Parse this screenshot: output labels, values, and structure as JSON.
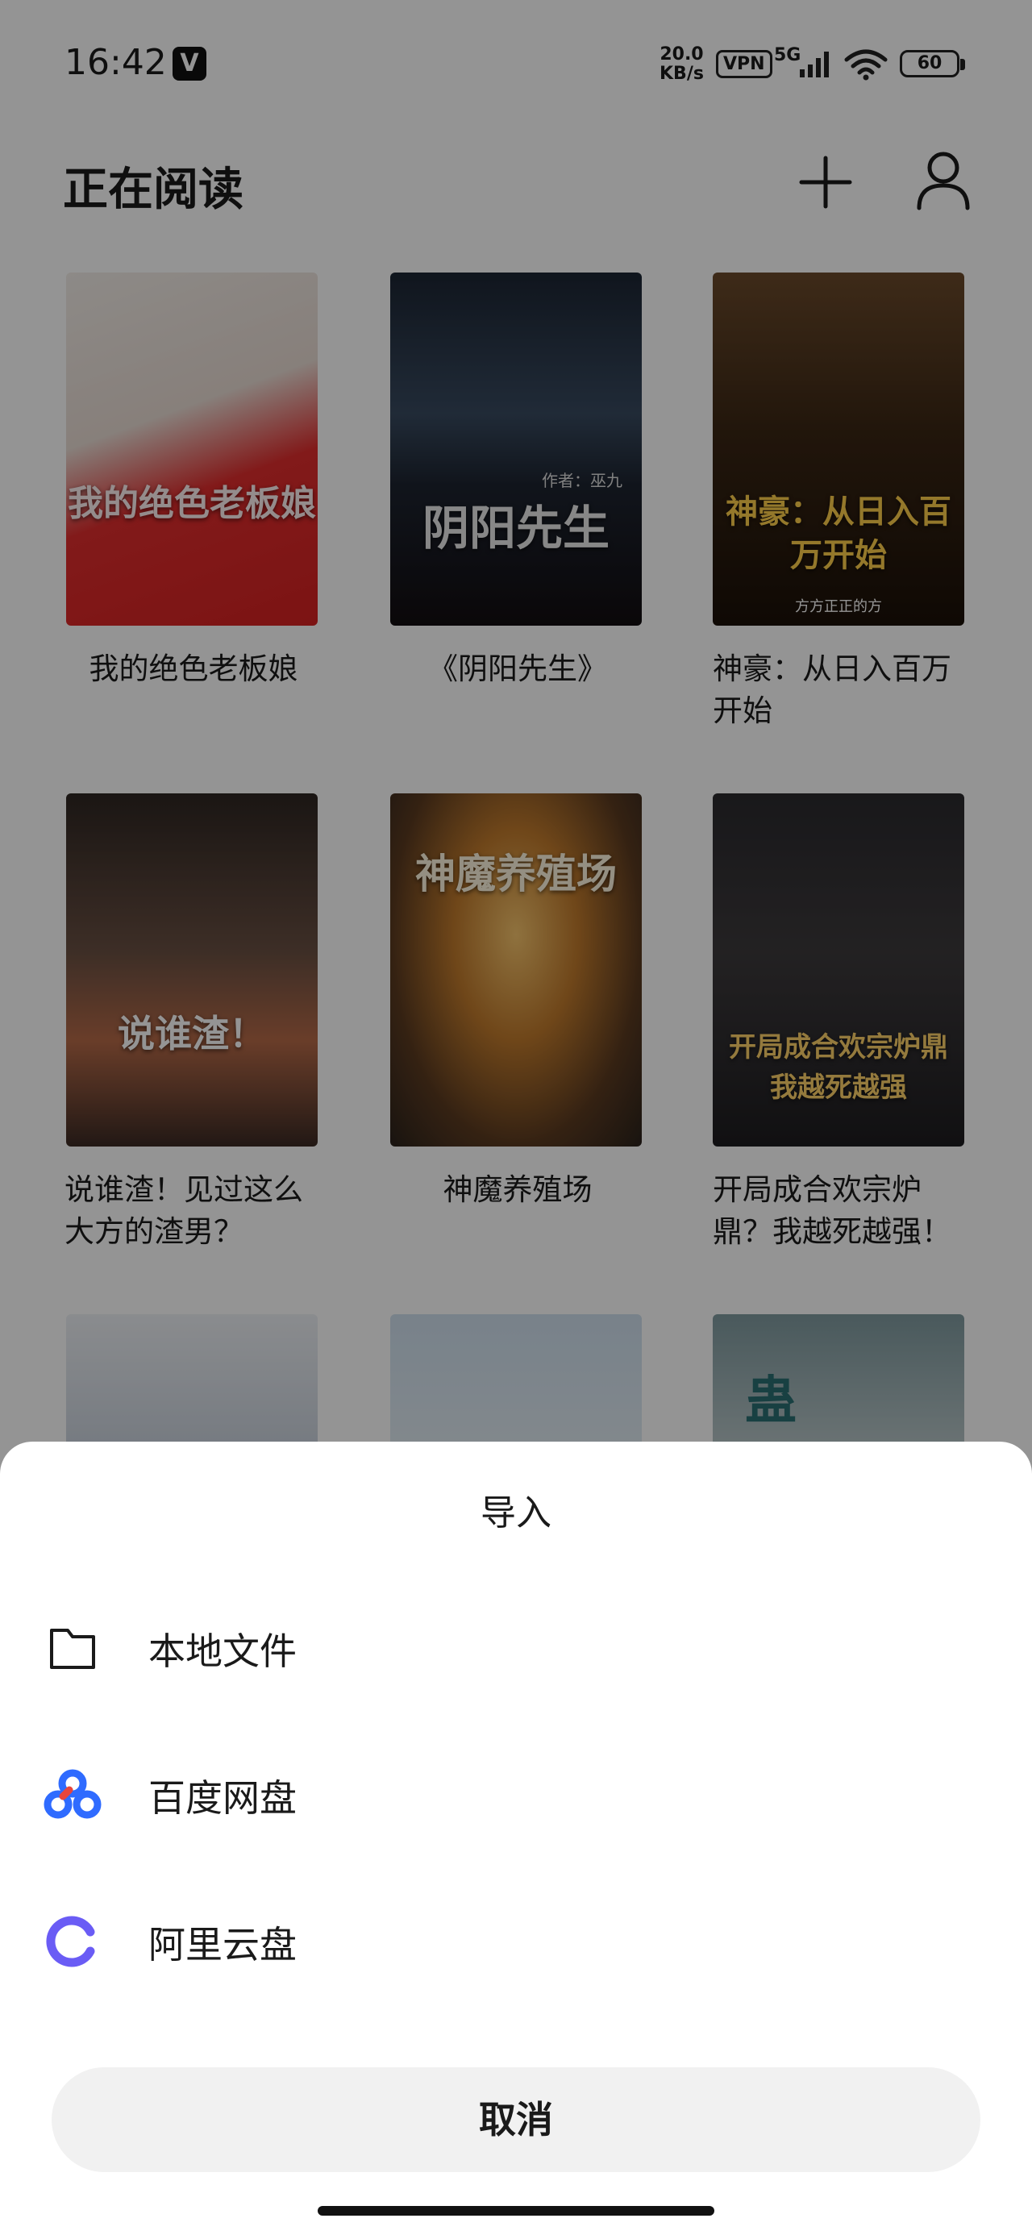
{
  "status_bar": {
    "time": "16:42",
    "app_badge": "V",
    "net_speed": "20.0\nKB/s",
    "vpn": "VPN",
    "network": "5G",
    "battery": "60"
  },
  "header": {
    "title": "正在阅读",
    "add_icon": "plus-icon",
    "profile_icon": "user-icon"
  },
  "books": [
    {
      "title": "我的绝色老板娘",
      "cover_text": "我的绝色老板娘",
      "cover_author": ""
    },
    {
      "title": "《阴阳先生》",
      "cover_text": "阴阳先生",
      "cover_author": "作者：巫九"
    },
    {
      "title": "神豪：从日入百万开始",
      "cover_text": "神豪：从日入百万开始",
      "cover_author": "方方正正的方"
    },
    {
      "title": "说谁渣！见过这么大方的渣男？",
      "cover_text": "说谁渣！",
      "cover_author": ""
    },
    {
      "title": "神魔养殖场",
      "cover_text": "神魔养殖场",
      "cover_author": ""
    },
    {
      "title": "开局成合欢宗炉鼎？我越死越强！",
      "cover_text": "开局成合欢宗炉鼎 我越死越强",
      "cover_author": ""
    },
    {
      "title": "",
      "cover_text": "",
      "cover_author": ""
    },
    {
      "title": "",
      "cover_text": "",
      "cover_author": ""
    },
    {
      "title": "",
      "cover_text": "蛊",
      "cover_author": ""
    }
  ],
  "sheet": {
    "title": "导入",
    "options": [
      {
        "label": "本地文件",
        "icon": "folder-icon"
      },
      {
        "label": "百度网盘",
        "icon": "baidu-netdisk-icon"
      },
      {
        "label": "阿里云盘",
        "icon": "aliyun-drive-icon"
      }
    ],
    "cancel": "取消"
  },
  "colors": {
    "baidu_blue": "#2f6bff",
    "baidu_red": "#e8453c",
    "aliyun_purple": "#6a5cf5"
  }
}
